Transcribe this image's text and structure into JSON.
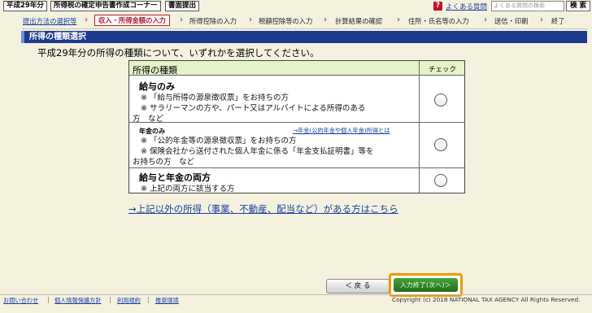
{
  "topbar": {
    "year_button": "平成29年分",
    "corner_button": "所得税の確定申告書作成コーナー",
    "submit_button": "書面提出",
    "faq_icon": "?",
    "faq_label": "よくある質問",
    "search_placeholder": "よくある質問の検索",
    "search_button": "検 索"
  },
  "steps": [
    "提出方法の選択等",
    "収入・所得金額の入力",
    "所得控除の入力",
    "税額控除等の入力",
    "計算結果の確認",
    "住所・氏名等の入力",
    "送信・印刷",
    "終了"
  ],
  "section_title": "所得の種類選択",
  "prompt": "平成29年分の所得の種類について、いずれかを選択してください。",
  "table": {
    "header_label": "所得の種類",
    "header_check": "チェック",
    "options": [
      {
        "title": "給与のみ",
        "lines": [
          "※ 「給与所得の源泉徴収票」をお持ちの方",
          "※ サラリーマンの方や、パート又はアルバイトによる所得のある",
          "方　など"
        ]
      },
      {
        "title": "年金のみ",
        "link": "→年金(公的年金や個人年金)所得とは",
        "lines": [
          "※ 「公的年金等の源泉徴収票」をお持ちの方",
          "※ 保険会社から送付された個人年金に係る「年金支払証明書」等を",
          "お持ちの方　など"
        ]
      },
      {
        "title": "給与と年金の両方",
        "lines": [
          "※ 上記の両方に該当する方"
        ]
      }
    ]
  },
  "other_link": "→上記以外の所得（事業、不動産、配当など）がある方はこちら",
  "nav": {
    "back": "＜ 戻 る",
    "next": "入力終了(次へ)＞"
  },
  "footer": {
    "links": [
      "お問い合わせ",
      "個人情報保護方針",
      "利用規約",
      "推奨環境"
    ],
    "separator": "|",
    "copyright": "Copyright (c) 2018 NATIONAL TAX AGENCY All Rights Reserved."
  },
  "colors": {
    "background": "#f4f2de",
    "header_blue": "#1c3a8e",
    "link_blue": "#1a3fa6",
    "current_step": "#b02030",
    "table_header": "#e6f2c8",
    "next_green": "#2a7d22",
    "highlight_orange": "#f39800"
  },
  "icons": {
    "faq": "question-mark-icon",
    "step_separator": "chevron-right-icon",
    "radio": "radio-circle-icon"
  }
}
